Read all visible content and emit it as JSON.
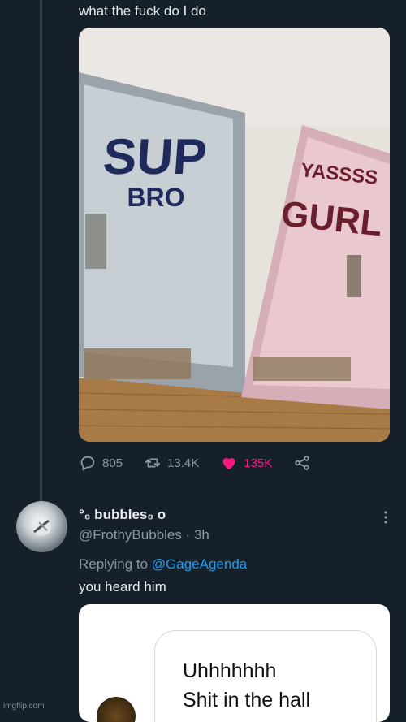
{
  "tweet": {
    "text": "what the fuck do I do",
    "image": {
      "left_door_top": "SUP",
      "left_door_bottom": "BRO",
      "right_door_top": "YASSSS",
      "right_door_bottom": "GURL"
    },
    "stats": {
      "replies": "805",
      "retweets": "13.4K",
      "likes": "135K"
    },
    "colors": {
      "like": "#f91880",
      "link": "#1d9bf0",
      "muted": "#8b98a5"
    }
  },
  "reply": {
    "display_name": "°₀ bubbles₀ o",
    "handle_time": "@FrothyBubbles · 3h",
    "replying_prefix": "Replying to",
    "replying_to": "@GageAgenda",
    "text": "you heard him",
    "quoted_lines": [
      "Uhhhhhhh",
      "Shit in the hall"
    ]
  },
  "watermark": "imgflip.com"
}
